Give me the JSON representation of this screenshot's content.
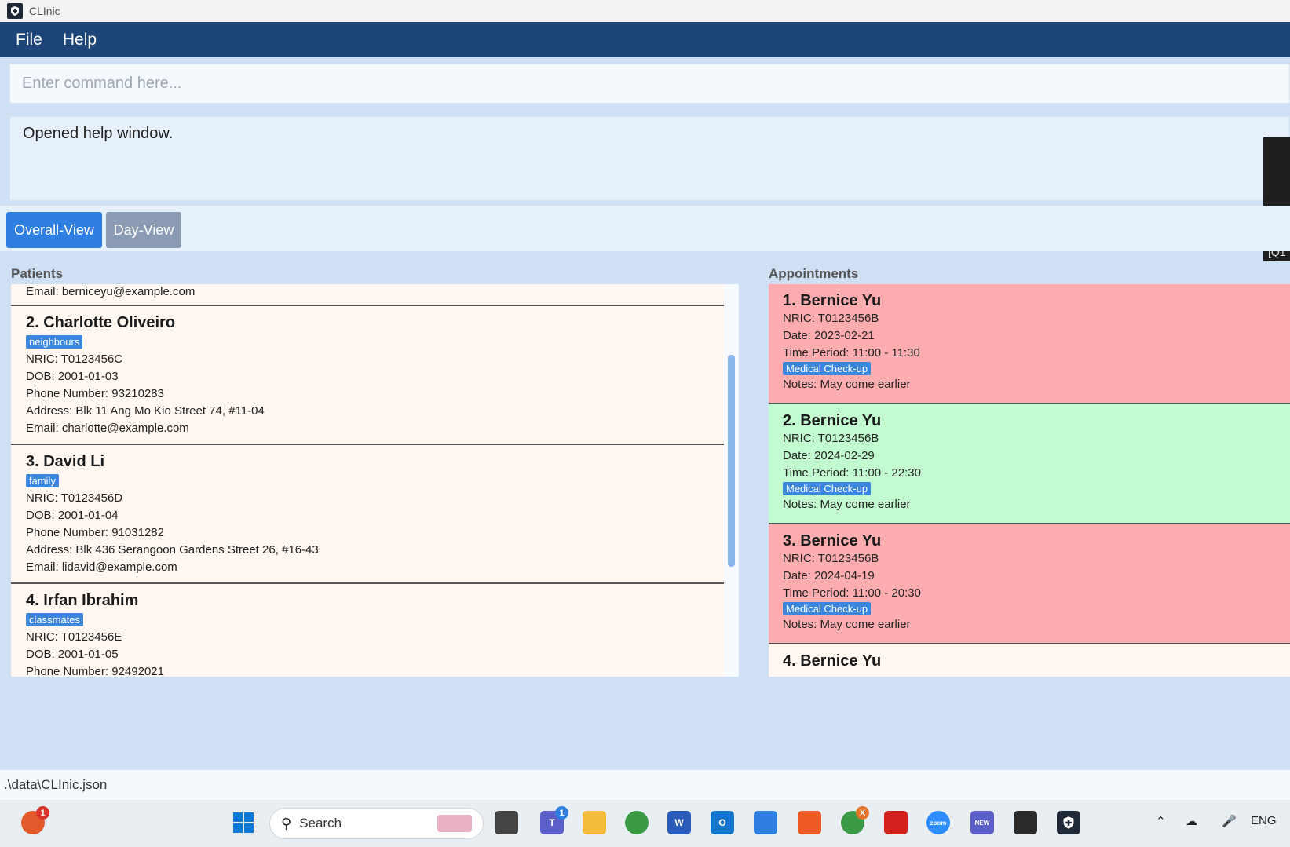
{
  "window": {
    "title": "CLInic"
  },
  "menu": {
    "file": "File",
    "help": "Help"
  },
  "command": {
    "placeholder": "Enter command here..."
  },
  "result": {
    "message": "Opened help window."
  },
  "popup": {
    "text": "[Q1"
  },
  "views": {
    "overall": "Overall-View",
    "day": "Day-View"
  },
  "patients": {
    "label": "Patients",
    "partial_top_email": "Email: berniceyu@example.com",
    "items": [
      {
        "name": "2.  Charlotte Oliveiro",
        "tag": "neighbours",
        "nric": "NRIC: T0123456C",
        "dob": "DOB: 2001-01-03",
        "phone": "Phone Number: 93210283",
        "address": "Address: Blk 11 Ang Mo Kio Street 74, #11-04",
        "email": "Email: charlotte@example.com"
      },
      {
        "name": "3.  David Li",
        "tag": "family",
        "nric": "NRIC: T0123456D",
        "dob": "DOB: 2001-01-04",
        "phone": "Phone Number: 91031282",
        "address": "Address: Blk 436 Serangoon Gardens Street 26, #16-43",
        "email": "Email: lidavid@example.com"
      },
      {
        "name": "4.  Irfan Ibrahim",
        "tag": "classmates",
        "nric": "NRIC: T0123456E",
        "dob": "DOB: 2001-01-05",
        "phone": "Phone Number: 92492021"
      }
    ]
  },
  "appointments": {
    "label": "Appointments",
    "items": [
      {
        "name": "1.  Bernice Yu",
        "nric": "NRIC: T0123456B",
        "date": "Date: 2023-02-21",
        "period": "Time Period: 11:00 - 11:30",
        "tag": "Medical Check-up",
        "notes": "Notes: May come earlier"
      },
      {
        "name": "2.  Bernice Yu",
        "nric": "NRIC: T0123456B",
        "date": "Date: 2024-02-29",
        "period": "Time Period: 11:00 - 22:30",
        "tag": "Medical Check-up",
        "notes": "Notes: May come earlier"
      },
      {
        "name": "3.  Bernice Yu",
        "nric": "NRIC: T0123456B",
        "date": "Date: 2024-04-19",
        "period": "Time Period: 11:00 - 20:30",
        "tag": "Medical Check-up",
        "notes": "Notes: May come earlier"
      },
      {
        "name": "4.  Bernice Yu"
      }
    ]
  },
  "status": {
    "path": ".\\data\\CLInic.json"
  },
  "taskbar": {
    "search": "Search",
    "lang": "ENG",
    "badge_alert": "1",
    "badge_teams": "1",
    "badge_chrome": "X",
    "teams_new": "NEW",
    "zoom": "zoom"
  },
  "colors": {
    "menu_bg": "#1e4577",
    "accent": "#2f7fe0",
    "appt_red": "#fdadb0",
    "appt_green": "#c3fbd0"
  }
}
